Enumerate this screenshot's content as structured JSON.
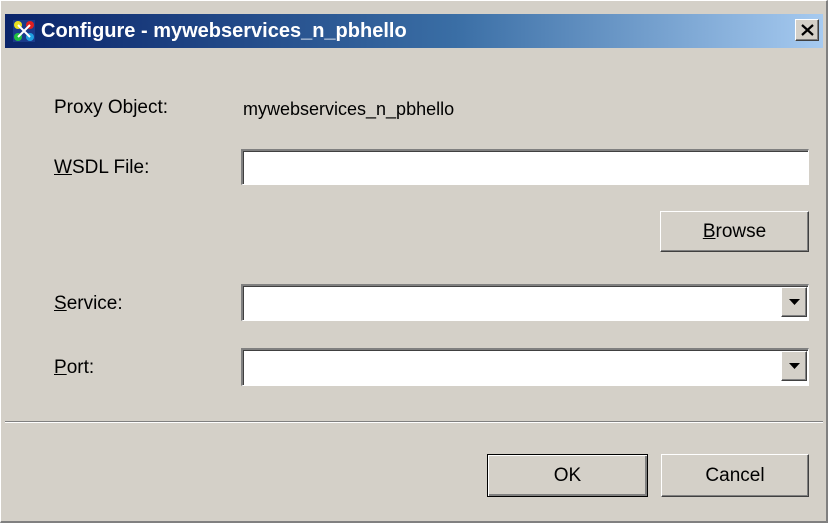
{
  "window": {
    "title": "Configure - mywebservices_n_pbhello",
    "close_label": "X",
    "colors": {
      "titlebar_start": "#0a246a",
      "titlebar_end": "#a6caf0",
      "face": "#d4d0c8"
    }
  },
  "form": {
    "proxy_object": {
      "label": "Proxy Object:",
      "value": "mywebservices_n_pbhello"
    },
    "wsdl_file": {
      "label_mnemonic": "W",
      "label_rest": "SDL File:",
      "value": ""
    },
    "browse_button": {
      "mnemonic": "B",
      "rest": "rowse"
    },
    "service": {
      "label_mnemonic": "S",
      "label_rest": "ervice:",
      "value": ""
    },
    "port": {
      "label_mnemonic": "P",
      "label_rest": "ort:",
      "value": ""
    }
  },
  "buttons": {
    "ok": "OK",
    "cancel": "Cancel"
  },
  "icons": {
    "app": "app-icon",
    "close": "close-icon",
    "dropdown": "chevron-down-icon"
  }
}
